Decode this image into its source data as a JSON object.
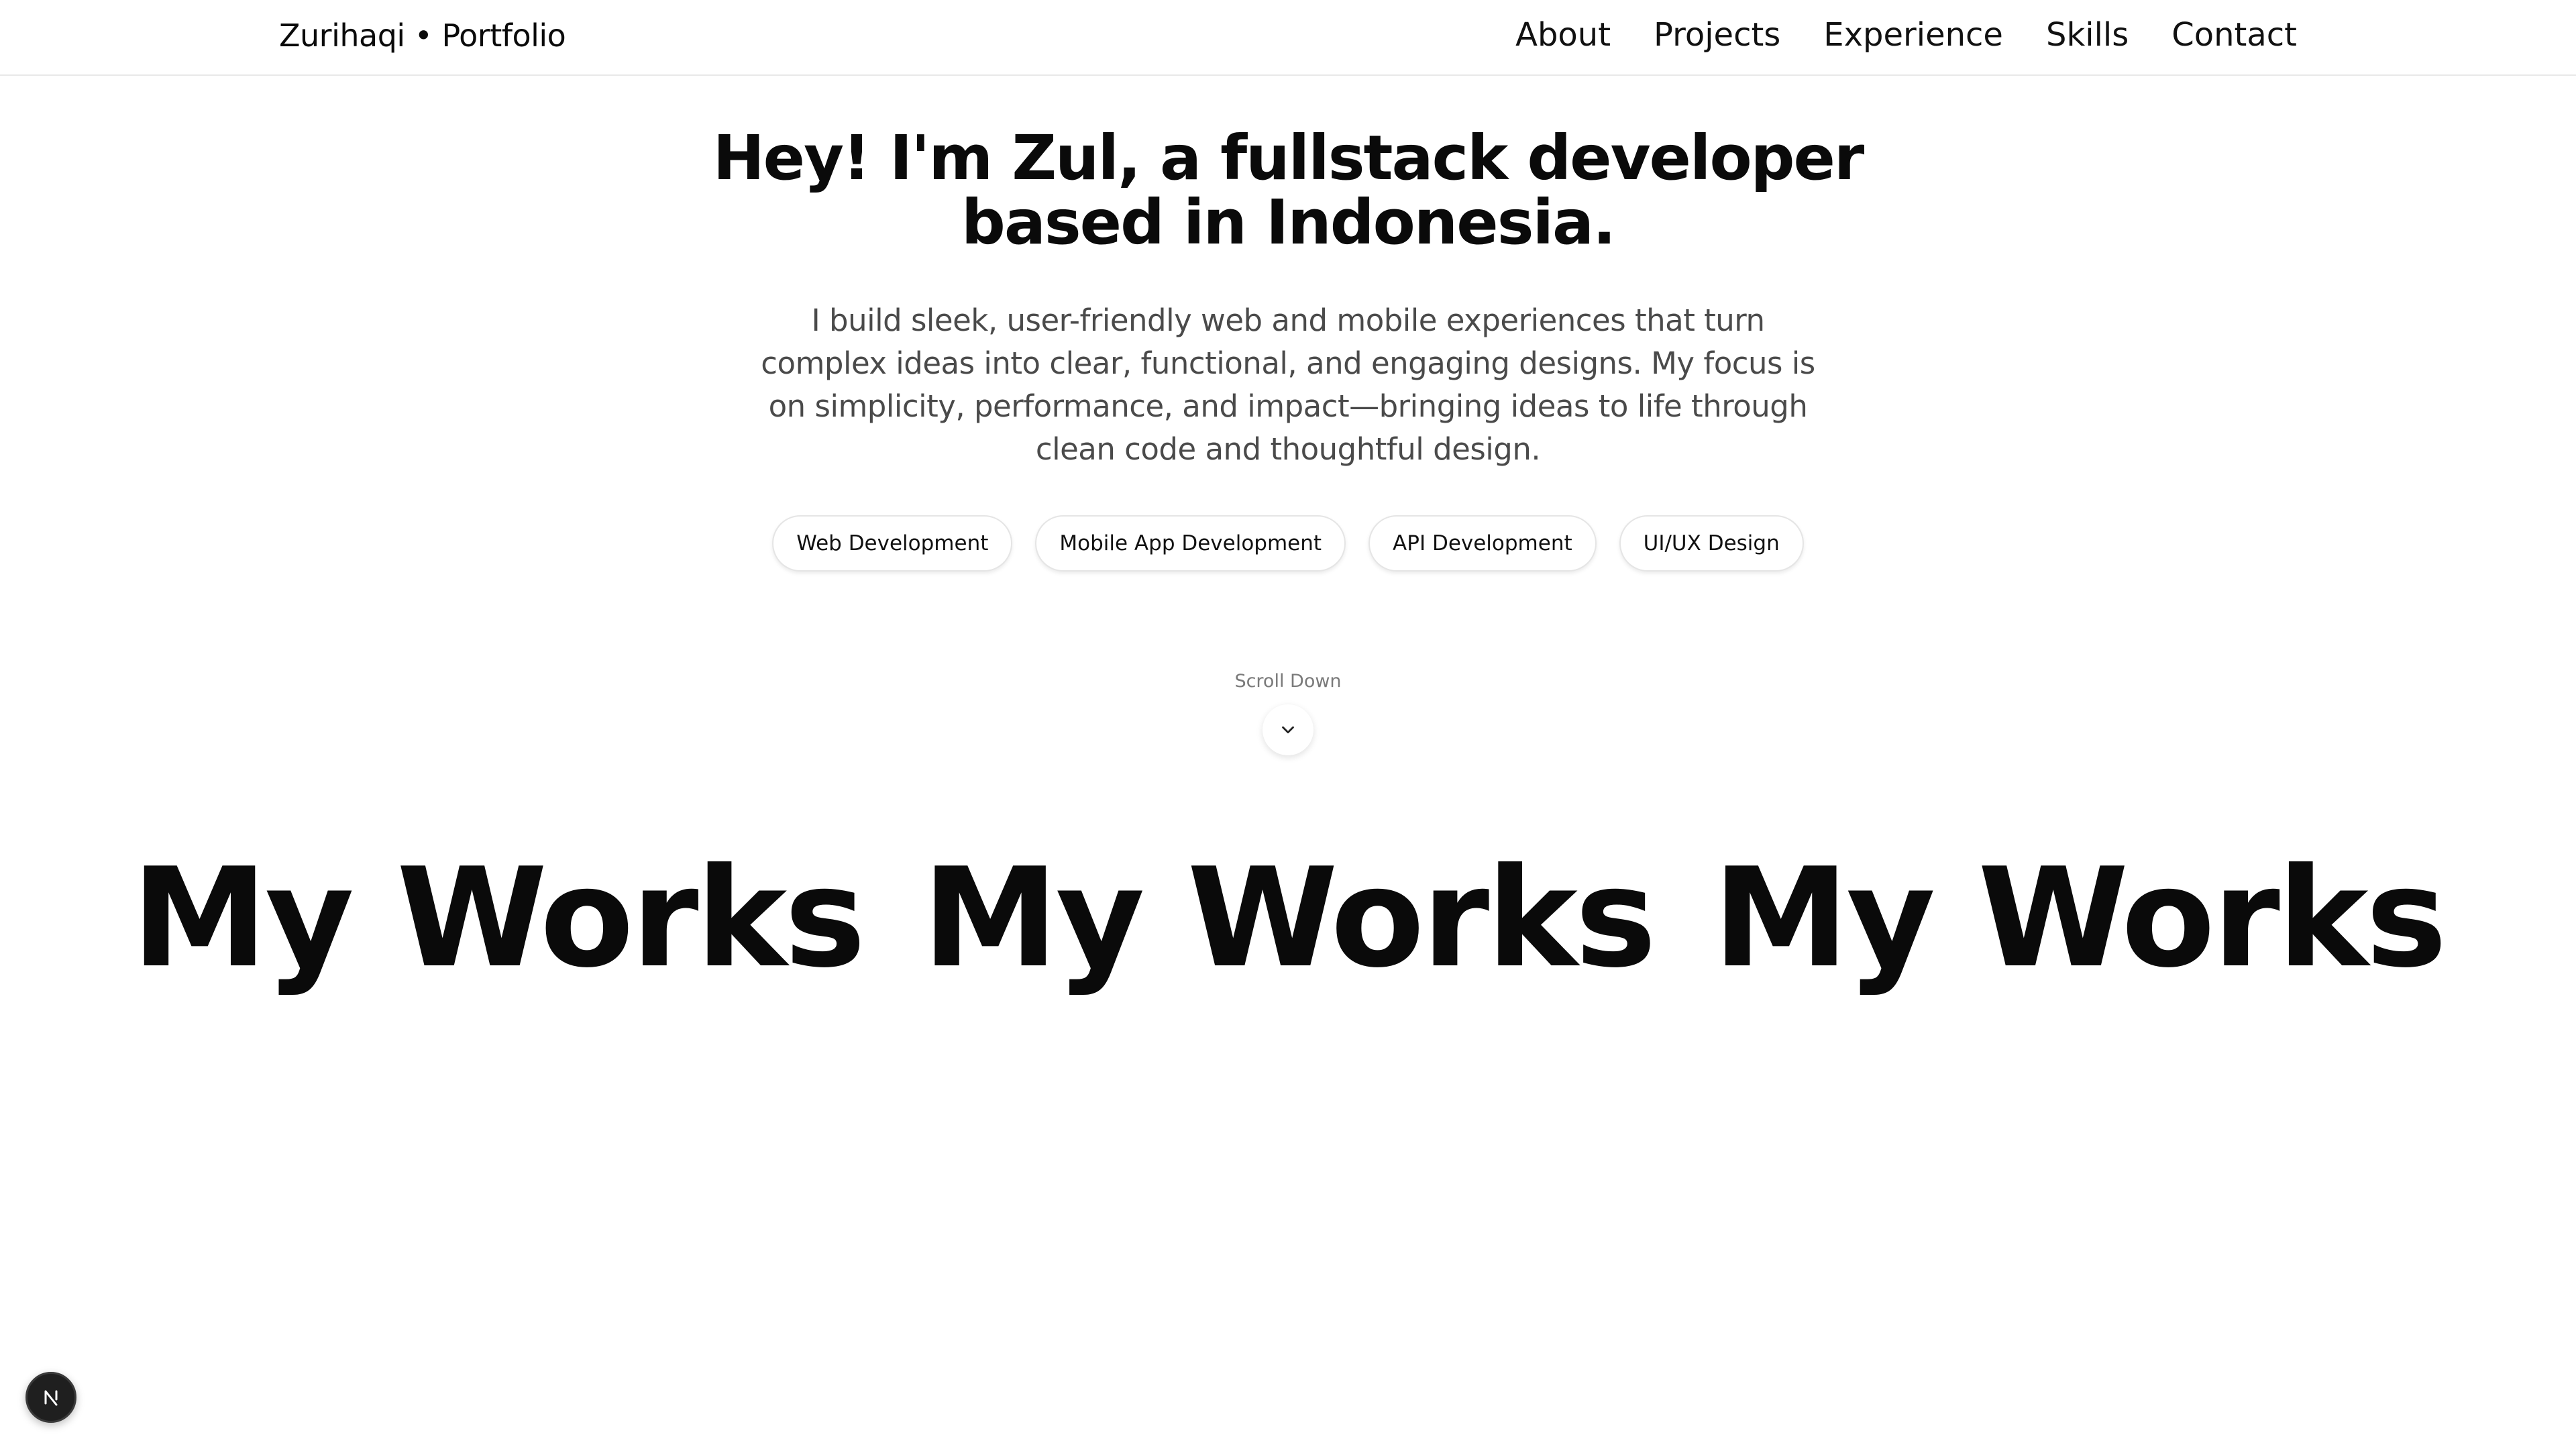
{
  "header": {
    "brand": "Zurihaqi • Portfolio",
    "nav": [
      {
        "label": "About"
      },
      {
        "label": "Projects"
      },
      {
        "label": "Experience"
      },
      {
        "label": "Skills"
      },
      {
        "label": "Contact"
      }
    ]
  },
  "hero": {
    "title_line1": "Hey! I'm Zul, a fullstack developer",
    "title_line2": "based in Indonesia.",
    "description": "I build sleek, user-friendly web and mobile experiences that turn complex ideas into clear, functional, and engaging designs. My focus is on simplicity, performance, and impact—bringing ideas to life through clean code and thoughtful design.",
    "tags": [
      {
        "label": "Web Development"
      },
      {
        "label": "Mobile App Development"
      },
      {
        "label": "API Development"
      },
      {
        "label": "UI/UX Design"
      }
    ],
    "scroll_label": "Scroll Down",
    "scroll_icon": "chevron-down-icon"
  },
  "works": {
    "items": [
      "My Works",
      "My Works",
      "My Works"
    ]
  },
  "dev_badge": {
    "label": "N",
    "icon": "nextjs-logo-icon"
  }
}
